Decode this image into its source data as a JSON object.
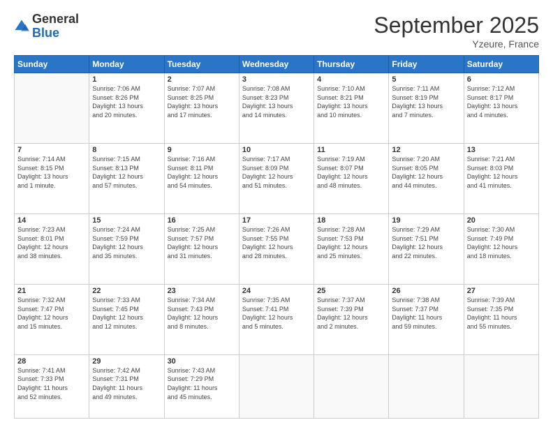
{
  "logo": {
    "general": "General",
    "blue": "Blue"
  },
  "header": {
    "month": "September 2025",
    "location": "Yzeure, France"
  },
  "days_of_week": [
    "Sunday",
    "Monday",
    "Tuesday",
    "Wednesday",
    "Thursday",
    "Friday",
    "Saturday"
  ],
  "weeks": [
    [
      {
        "day": "",
        "info": ""
      },
      {
        "day": "1",
        "info": "Sunrise: 7:06 AM\nSunset: 8:26 PM\nDaylight: 13 hours\nand 20 minutes."
      },
      {
        "day": "2",
        "info": "Sunrise: 7:07 AM\nSunset: 8:25 PM\nDaylight: 13 hours\nand 17 minutes."
      },
      {
        "day": "3",
        "info": "Sunrise: 7:08 AM\nSunset: 8:23 PM\nDaylight: 13 hours\nand 14 minutes."
      },
      {
        "day": "4",
        "info": "Sunrise: 7:10 AM\nSunset: 8:21 PM\nDaylight: 13 hours\nand 10 minutes."
      },
      {
        "day": "5",
        "info": "Sunrise: 7:11 AM\nSunset: 8:19 PM\nDaylight: 13 hours\nand 7 minutes."
      },
      {
        "day": "6",
        "info": "Sunrise: 7:12 AM\nSunset: 8:17 PM\nDaylight: 13 hours\nand 4 minutes."
      }
    ],
    [
      {
        "day": "7",
        "info": "Sunrise: 7:14 AM\nSunset: 8:15 PM\nDaylight: 13 hours\nand 1 minute."
      },
      {
        "day": "8",
        "info": "Sunrise: 7:15 AM\nSunset: 8:13 PM\nDaylight: 12 hours\nand 57 minutes."
      },
      {
        "day": "9",
        "info": "Sunrise: 7:16 AM\nSunset: 8:11 PM\nDaylight: 12 hours\nand 54 minutes."
      },
      {
        "day": "10",
        "info": "Sunrise: 7:17 AM\nSunset: 8:09 PM\nDaylight: 12 hours\nand 51 minutes."
      },
      {
        "day": "11",
        "info": "Sunrise: 7:19 AM\nSunset: 8:07 PM\nDaylight: 12 hours\nand 48 minutes."
      },
      {
        "day": "12",
        "info": "Sunrise: 7:20 AM\nSunset: 8:05 PM\nDaylight: 12 hours\nand 44 minutes."
      },
      {
        "day": "13",
        "info": "Sunrise: 7:21 AM\nSunset: 8:03 PM\nDaylight: 12 hours\nand 41 minutes."
      }
    ],
    [
      {
        "day": "14",
        "info": "Sunrise: 7:23 AM\nSunset: 8:01 PM\nDaylight: 12 hours\nand 38 minutes."
      },
      {
        "day": "15",
        "info": "Sunrise: 7:24 AM\nSunset: 7:59 PM\nDaylight: 12 hours\nand 35 minutes."
      },
      {
        "day": "16",
        "info": "Sunrise: 7:25 AM\nSunset: 7:57 PM\nDaylight: 12 hours\nand 31 minutes."
      },
      {
        "day": "17",
        "info": "Sunrise: 7:26 AM\nSunset: 7:55 PM\nDaylight: 12 hours\nand 28 minutes."
      },
      {
        "day": "18",
        "info": "Sunrise: 7:28 AM\nSunset: 7:53 PM\nDaylight: 12 hours\nand 25 minutes."
      },
      {
        "day": "19",
        "info": "Sunrise: 7:29 AM\nSunset: 7:51 PM\nDaylight: 12 hours\nand 22 minutes."
      },
      {
        "day": "20",
        "info": "Sunrise: 7:30 AM\nSunset: 7:49 PM\nDaylight: 12 hours\nand 18 minutes."
      }
    ],
    [
      {
        "day": "21",
        "info": "Sunrise: 7:32 AM\nSunset: 7:47 PM\nDaylight: 12 hours\nand 15 minutes."
      },
      {
        "day": "22",
        "info": "Sunrise: 7:33 AM\nSunset: 7:45 PM\nDaylight: 12 hours\nand 12 minutes."
      },
      {
        "day": "23",
        "info": "Sunrise: 7:34 AM\nSunset: 7:43 PM\nDaylight: 12 hours\nand 8 minutes."
      },
      {
        "day": "24",
        "info": "Sunrise: 7:35 AM\nSunset: 7:41 PM\nDaylight: 12 hours\nand 5 minutes."
      },
      {
        "day": "25",
        "info": "Sunrise: 7:37 AM\nSunset: 7:39 PM\nDaylight: 12 hours\nand 2 minutes."
      },
      {
        "day": "26",
        "info": "Sunrise: 7:38 AM\nSunset: 7:37 PM\nDaylight: 11 hours\nand 59 minutes."
      },
      {
        "day": "27",
        "info": "Sunrise: 7:39 AM\nSunset: 7:35 PM\nDaylight: 11 hours\nand 55 minutes."
      }
    ],
    [
      {
        "day": "28",
        "info": "Sunrise: 7:41 AM\nSunset: 7:33 PM\nDaylight: 11 hours\nand 52 minutes."
      },
      {
        "day": "29",
        "info": "Sunrise: 7:42 AM\nSunset: 7:31 PM\nDaylight: 11 hours\nand 49 minutes."
      },
      {
        "day": "30",
        "info": "Sunrise: 7:43 AM\nSunset: 7:29 PM\nDaylight: 11 hours\nand 45 minutes."
      },
      {
        "day": "",
        "info": ""
      },
      {
        "day": "",
        "info": ""
      },
      {
        "day": "",
        "info": ""
      },
      {
        "day": "",
        "info": ""
      }
    ]
  ]
}
